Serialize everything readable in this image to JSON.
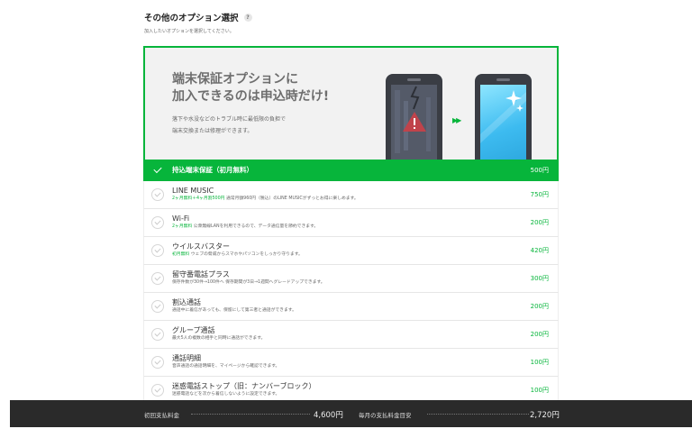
{
  "section": {
    "title": "その他のオプション選択",
    "help_icon": "?",
    "subtitle": "加入したいオプションを選択してください。"
  },
  "banner": {
    "headline_line1": "端末保証オプションに",
    "headline_line2": "加入できるのは申込時だけ!",
    "body_line1": "落下や水没などのトラブル時に最低限の負担で",
    "body_line2": "端末交換または修理ができます。",
    "arrow": "▶▶"
  },
  "options": [
    {
      "name": "持込端末保証（初月無料）",
      "tag": "",
      "desc": "",
      "price": "500円",
      "selected": true
    },
    {
      "name": "LINE MUSIC",
      "tag": "2ヶ月無料＋4ヶ月割500円",
      "desc": "通常月額960円（税込）のLINE MUSICがずっとお得に楽しめます。",
      "price": "750円",
      "selected": false
    },
    {
      "name": "Wi-Fi",
      "tag": "2ヶ月無料",
      "desc": "公衆無線LANを利用できるので、データ通信量を節約できます。",
      "price": "200円",
      "selected": false
    },
    {
      "name": "ウイルスバスター",
      "tag": "初月無料",
      "desc": "ウェブの脅威からスマホやパソコンをしっかり守ります。",
      "price": "420円",
      "selected": false
    },
    {
      "name": "留守番電話プラス",
      "tag": "",
      "desc": "保存件数が30件→100件へ 保存期間が3日→1週間へグレードアップできます。",
      "price": "300円",
      "selected": false
    },
    {
      "name": "割込通話",
      "tag": "",
      "desc": "通話中に着信があっても、保留にして第三者と通話ができます。",
      "price": "200円",
      "selected": false
    },
    {
      "name": "グループ通話",
      "tag": "",
      "desc": "最大5人の複数の相手と同時に通話ができます。",
      "price": "200円",
      "selected": false
    },
    {
      "name": "通話明細",
      "tag": "",
      "desc": "音声通話の通話明細を、マイページから確認できます。",
      "price": "100円",
      "selected": false
    },
    {
      "name": "迷惑電話ストップ（旧：ナンバーブロック）",
      "tag": "",
      "desc": "迷惑電話などを次から着信しないように設定できます。",
      "price": "100円",
      "selected": false
    }
  ],
  "footer": {
    "initial_label": "初回支払料金",
    "initial_value": "4,600円",
    "monthly_label": "毎月の支払料金目安",
    "monthly_value": "2,720円"
  },
  "colors": {
    "accent": "#07b53b",
    "footer_bg": "#2a2a2a"
  }
}
